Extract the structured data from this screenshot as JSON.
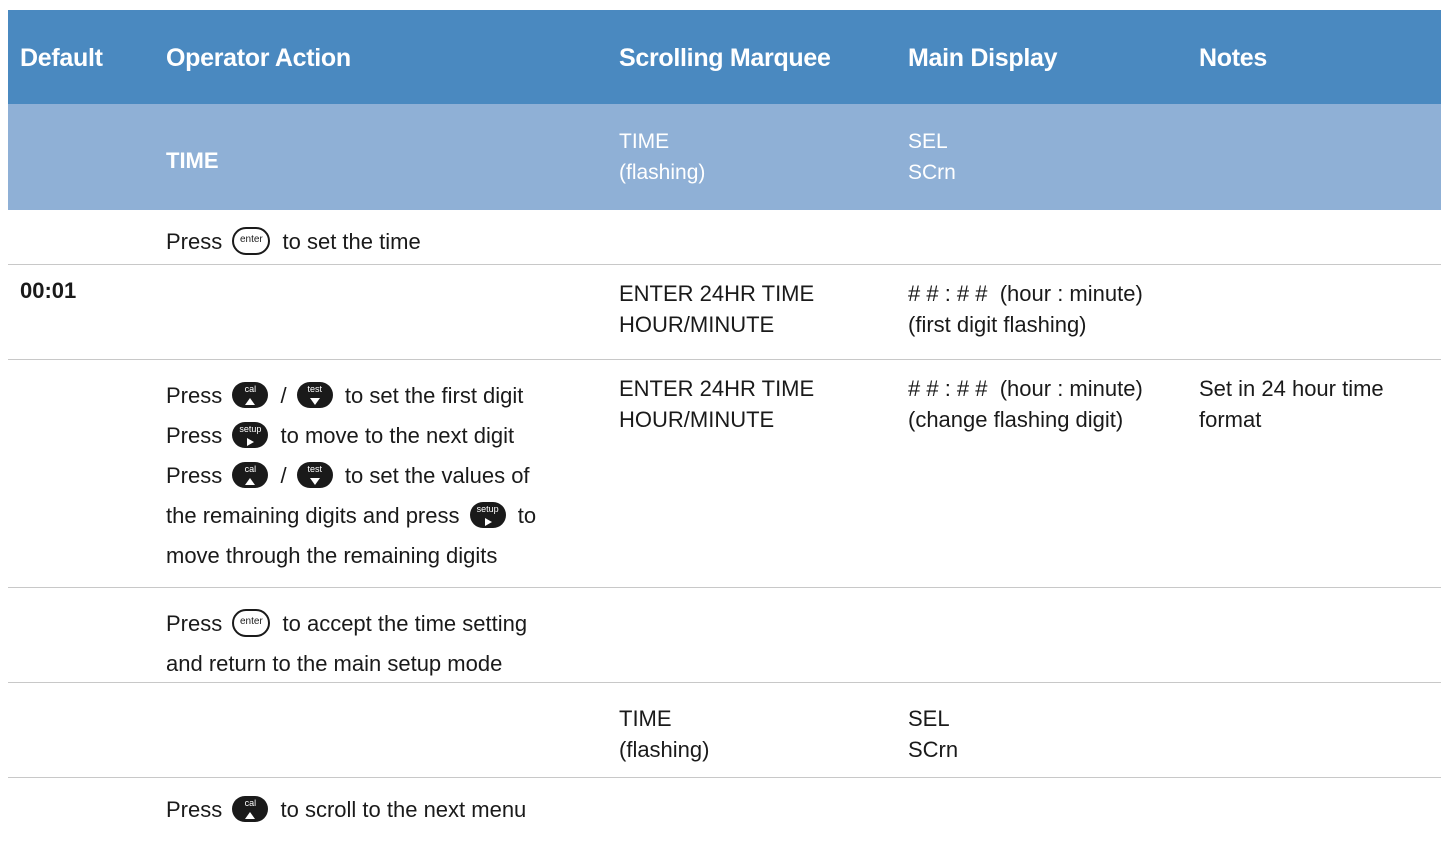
{
  "header": {
    "default": "Default",
    "operator_action": "Operator Action",
    "scrolling_marquee": "Scrolling Marquee",
    "main_display": "Main Display",
    "notes": "Notes"
  },
  "section": {
    "title": "TIME",
    "marquee_1": "TIME",
    "marquee_2": "(flashing)",
    "main_1": "SEL",
    "main_2": "SCrn"
  },
  "keys": {
    "enter": "enter",
    "cal": "cal",
    "test": "test",
    "setup": "setup"
  },
  "rows": [
    {
      "action": {
        "pre": "Press",
        "post": "to set the time"
      }
    },
    {
      "default": "00:01",
      "marquee_1": "ENTER 24HR TIME",
      "marquee_2": "HOUR/MINUTE",
      "main_1": "# # : # #  (hour : minute)",
      "main_2": "(first digit flashing)"
    },
    {
      "action": {
        "l1_pre": "Press",
        "l1_sep": "/",
        "l1_post": "to set the first digit",
        "l2_pre": "Press",
        "l2_post": "to move to the next digit",
        "l3_pre": "Press",
        "l3_sep": "/",
        "l3_post": "to set the values of",
        "l4_pre": "the remaining digits and press",
        "l4_post": "to",
        "l5": "move through the remaining digits"
      },
      "marquee_1": "ENTER 24HR TIME",
      "marquee_2": "HOUR/MINUTE",
      "main_1": "# # : # #  (hour : minute)",
      "main_2": "(change flashing digit)",
      "notes_1": "Set in 24 hour time",
      "notes_2": "format"
    },
    {
      "action": {
        "l1_pre": "Press",
        "l1_post": "to accept the time setting",
        "l2": "and return to the main setup mode"
      }
    },
    {
      "marquee_1": "TIME",
      "marquee_2": "(flashing)",
      "main_1": "SEL",
      "main_2": "SCrn"
    },
    {
      "action": {
        "pre": "Press",
        "post": "to scroll to the next menu"
      }
    }
  ]
}
